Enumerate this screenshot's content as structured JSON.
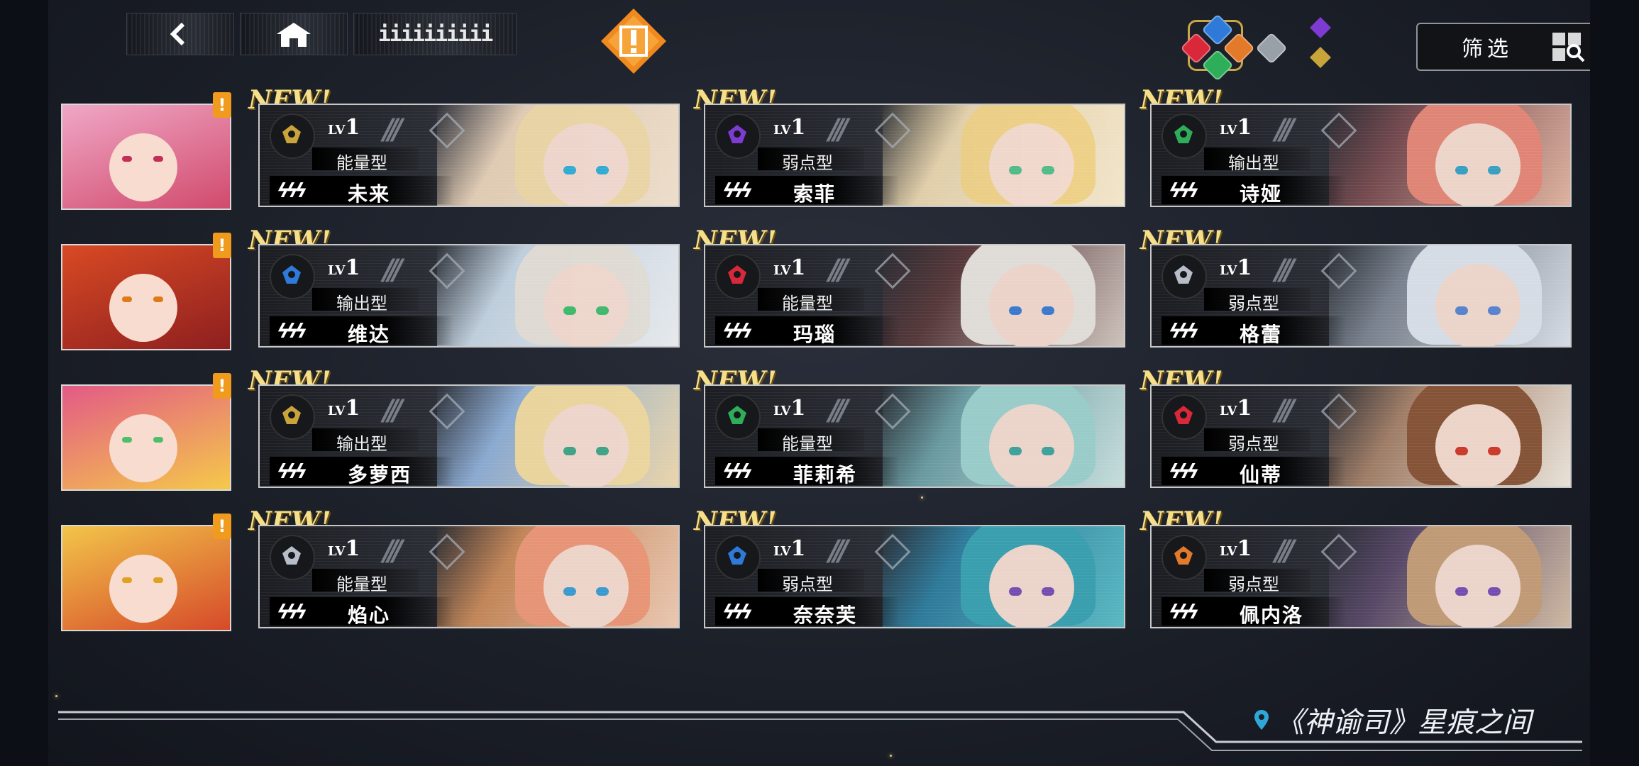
{
  "nav": {
    "back_icon": "back-arrow-icon",
    "home_icon": "home-icon",
    "tab_label": "iiiiiiiiii",
    "alert_label": "!"
  },
  "filter": {
    "label": "筛选",
    "elements": [
      "red",
      "blue",
      "orange",
      "green",
      "silver",
      "purple",
      "gold"
    ]
  },
  "new_label": "NEW!",
  "rows": [
    {
      "portrait": {
        "hair": "#f0a7c6",
        "accent": "#d14a6c",
        "eye": "#c42d55"
      },
      "badge": "!",
      "cards": [
        {
          "lv_prefix": "LV",
          "lv": "1",
          "type": "能量型",
          "name": "未来",
          "element": "gold",
          "tint": "#6d6a8e",
          "art1": "#e8d2b8",
          "art2": "#f3e4ce",
          "hair": "#f1dba9",
          "eye": "#2fb0d8"
        },
        {
          "lv_prefix": "LV",
          "lv": "1",
          "type": "弱点型",
          "name": "索菲",
          "element": "purple",
          "tint": "#c5b07a",
          "art1": "#e9d6b0",
          "art2": "#f4e8cf",
          "hair": "#f2d48a",
          "eye": "#4fbf8b"
        },
        {
          "lv_prefix": "LV",
          "lv": "1",
          "type": "输出型",
          "name": "诗娅",
          "element": "green",
          "tint": "#3b2d31",
          "art1": "#7a4d52",
          "art2": "#e7b9a5",
          "hair": "#e98a7a",
          "eye": "#3aa6c9"
        }
      ]
    },
    {
      "portrait": {
        "hair": "#d84a24",
        "accent": "#8e1f1f",
        "eye": "#e07a18"
      },
      "badge": "!",
      "cards": [
        {
          "lv_prefix": "LV",
          "lv": "1",
          "type": "输出型",
          "name": "维达",
          "element": "blue",
          "tint": "#5e6f86",
          "art1": "#c6d6e4",
          "art2": "#eef0f2",
          "hair": "#e7e2da",
          "eye": "#3fbf6c"
        },
        {
          "lv_prefix": "LV",
          "lv": "1",
          "type": "能量型",
          "name": "玛瑙",
          "element": "red",
          "tint": "#2a2226",
          "art1": "#5a3a3c",
          "art2": "#d6cbc4",
          "hair": "#e9e6e2",
          "eye": "#3b7fd6"
        },
        {
          "lv_prefix": "LV",
          "lv": "1",
          "type": "弱点型",
          "name": "格蕾",
          "element": "silver",
          "tint": "#2e323a",
          "art1": "#7c8591",
          "art2": "#dfe5ee",
          "hair": "#dfe6ef",
          "eye": "#5a87d6"
        }
      ]
    },
    {
      "portrait": {
        "hair": "#e35a86",
        "accent": "#f5c94a",
        "eye": "#4dbf6a"
      },
      "badge": "!",
      "cards": [
        {
          "lv_prefix": "LV",
          "lv": "1",
          "type": "输出型",
          "name": "多萝西",
          "element": "gold",
          "tint": "#5a5f74",
          "art1": "#8fb0d8",
          "art2": "#f2dcae",
          "hair": "#f3dca2",
          "eye": "#3fa78a"
        },
        {
          "lv_prefix": "LV",
          "lv": "1",
          "type": "能量型",
          "name": "菲莉希亚",
          "element": "green",
          "tint": "#2c3a43",
          "art1": "#6da0a6",
          "art2": "#cfe6e4",
          "hair": "#9fd4d0",
          "eye": "#3fa7a0"
        },
        {
          "lv_prefix": "LV",
          "lv": "1",
          "type": "弱点型",
          "name": "仙蒂",
          "element": "red",
          "tint": "#3c3431",
          "art1": "#a6826a",
          "art2": "#f2ebe1",
          "hair": "#8a5538",
          "eye": "#d33a2a"
        }
      ]
    },
    {
      "portrait": {
        "hair": "#f2c54a",
        "accent": "#d64a2a",
        "eye": "#e0a020"
      },
      "badge": "!",
      "cards": [
        {
          "lv_prefix": "LV",
          "lv": "1",
          "type": "能量型",
          "name": "焰心",
          "element": "silver",
          "tint": "#5a3a2e",
          "art1": "#c98a5a",
          "art2": "#f2cfb8",
          "hair": "#f09a7a",
          "eye": "#3aa0d8"
        },
        {
          "lv_prefix": "LV",
          "lv": "1",
          "type": "弱点型",
          "name": "奈奈芙",
          "element": "blue",
          "tint": "#2a3b4e",
          "art1": "#2f7fa0",
          "art2": "#5cc0c8",
          "hair": "#3aa4b4",
          "eye": "#7a4fb8"
        },
        {
          "lv_prefix": "LV",
          "lv": "1",
          "type": "弱点型",
          "name": "佩内洛普",
          "element": "orange",
          "tint": "#2b2b3a",
          "art1": "#5a4a6a",
          "art2": "#d8c0a8",
          "hair": "#c8a07a",
          "eye": "#7a4fb8"
        }
      ]
    }
  ],
  "footer": {
    "location": "《神谕司》星痕之间",
    "pin_icon": "location-pin-icon"
  },
  "colors": {
    "accent_orange": "#f09a1e",
    "new_gold": "#f5df8a",
    "filter_border": "#8e939c"
  }
}
